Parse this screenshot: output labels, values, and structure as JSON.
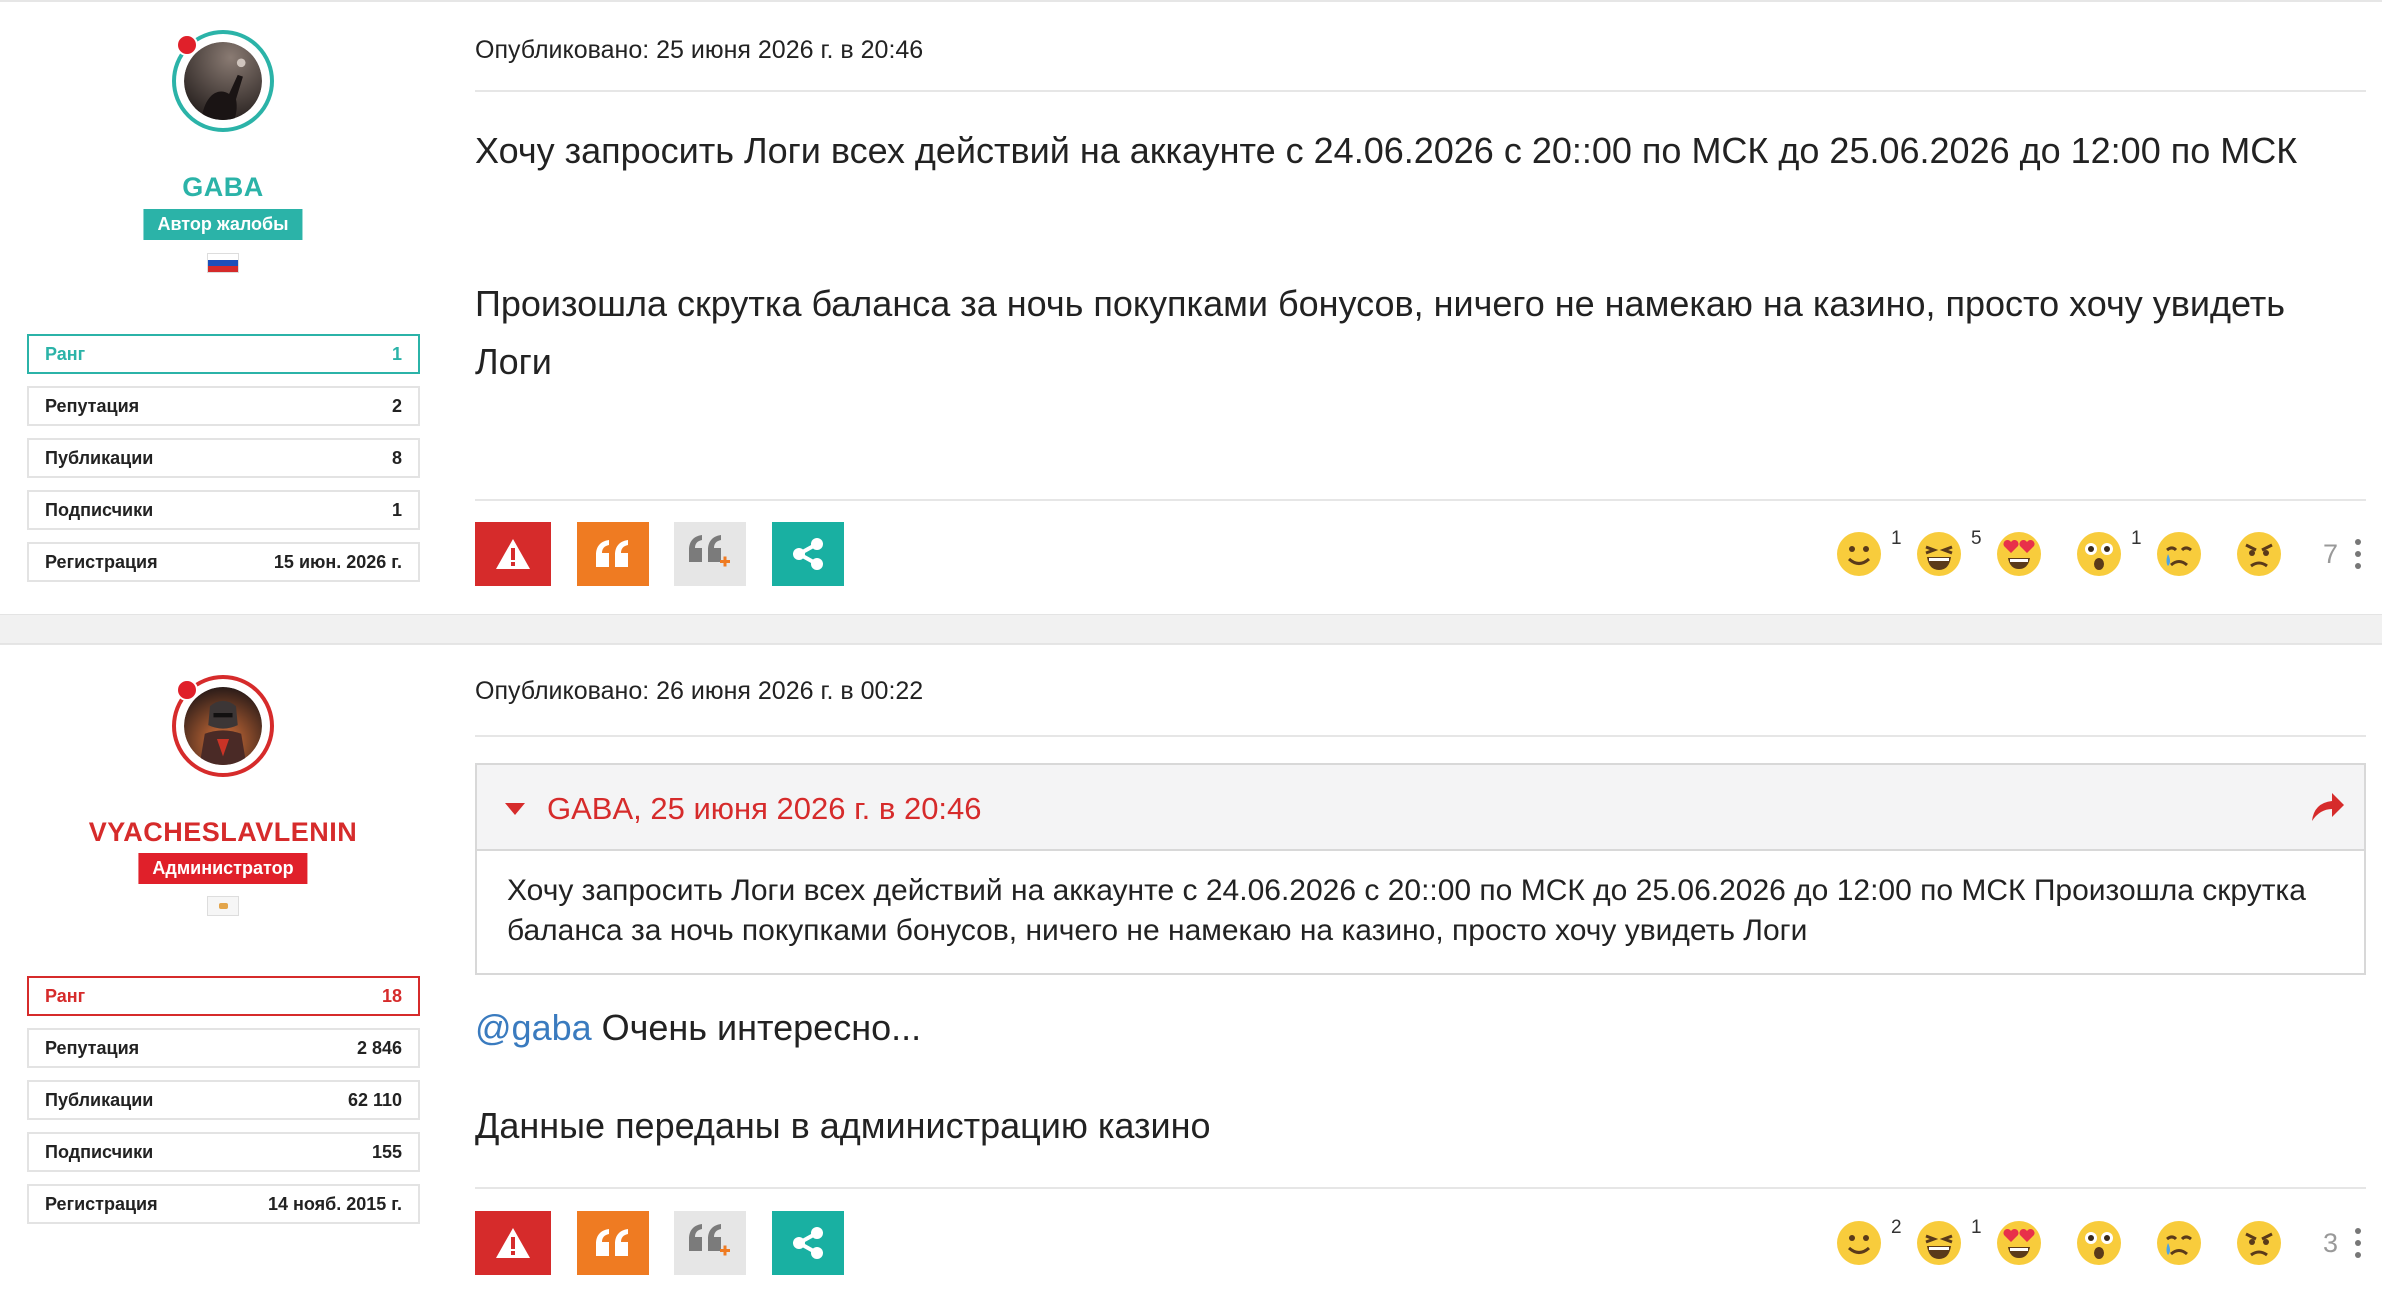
{
  "posts": [
    {
      "author": {
        "name": "GABA",
        "role": "Автор жалобы",
        "name_color": "#2bb3a8",
        "role_color": "#2bb3a8",
        "flag": "ru-flag",
        "stats": [
          {
            "label": "Ранг",
            "value": "1"
          },
          {
            "label": "Репутация",
            "value": "2"
          },
          {
            "label": "Публикации",
            "value": "8"
          },
          {
            "label": "Подписчики",
            "value": "1"
          },
          {
            "label": "Регистрация",
            "value": "15 июн. 2026 г."
          }
        ]
      },
      "published": "Опубликовано: 25 июня 2026 г. в 20:46",
      "paragraphs": [
        "Хочу запросить Логи всех действий на аккаунте с 24.06.2026 с 20::00 по МСК до 25.06.2026 до 12:00 по МСК",
        "Произошла скрутка баланса за ночь покупками бонусов, ничего не намекаю на казино, просто хочу увидеть Логи"
      ],
      "reactions": [
        {
          "icon": "smile-icon",
          "count": "1"
        },
        {
          "icon": "laugh-icon",
          "count": "5"
        },
        {
          "icon": "heart-eyes-icon",
          "count": ""
        },
        {
          "icon": "surprised-icon",
          "count": "1"
        },
        {
          "icon": "cry-icon",
          "count": ""
        },
        {
          "icon": "angry-icon",
          "count": ""
        }
      ],
      "total_reactions": "7"
    },
    {
      "author": {
        "name": "VYACHESLAVLENIN",
        "role": "Администратор",
        "name_color": "#d62b2b",
        "role_color": "#e0202a",
        "flag": "cy-flag",
        "stats": [
          {
            "label": "Ранг",
            "value": "18"
          },
          {
            "label": "Репутация",
            "value": "2 846"
          },
          {
            "label": "Публикации",
            "value": "62 110"
          },
          {
            "label": "Подписчики",
            "value": "155"
          },
          {
            "label": "Регистрация",
            "value": "14 нояб. 2015 г."
          }
        ]
      },
      "published": "Опубликовано: 26 июня 2026 г. в 00:22",
      "quote": {
        "header": "GABA, 25 июня 2026 г. в 20:46",
        "body": "Хочу запросить Логи всех действий на аккаунте с 24.06.2026 с 20::00 по МСК до 25.06.2026 до 12:00 по МСК Произошла скрутка баланса за ночь покупками бонусов, ничего не намекаю на казино, просто хочу увидеть Логи"
      },
      "mention": "@gaba",
      "paragraphs": [
        " Очень интересно...",
        "Данные переданы в администрацию казино"
      ],
      "reactions": [
        {
          "icon": "smile-icon",
          "count": "2"
        },
        {
          "icon": "laugh-icon",
          "count": "1"
        },
        {
          "icon": "heart-eyes-icon",
          "count": ""
        },
        {
          "icon": "surprised-icon",
          "count": ""
        },
        {
          "icon": "cry-icon",
          "count": ""
        },
        {
          "icon": "angry-icon",
          "count": ""
        }
      ],
      "total_reactions": "3"
    }
  ],
  "colors": {
    "report": "#d62b2b",
    "quote": "#ef7b22",
    "multiquote": "#e6e6e6",
    "share": "#19b0a2"
  }
}
